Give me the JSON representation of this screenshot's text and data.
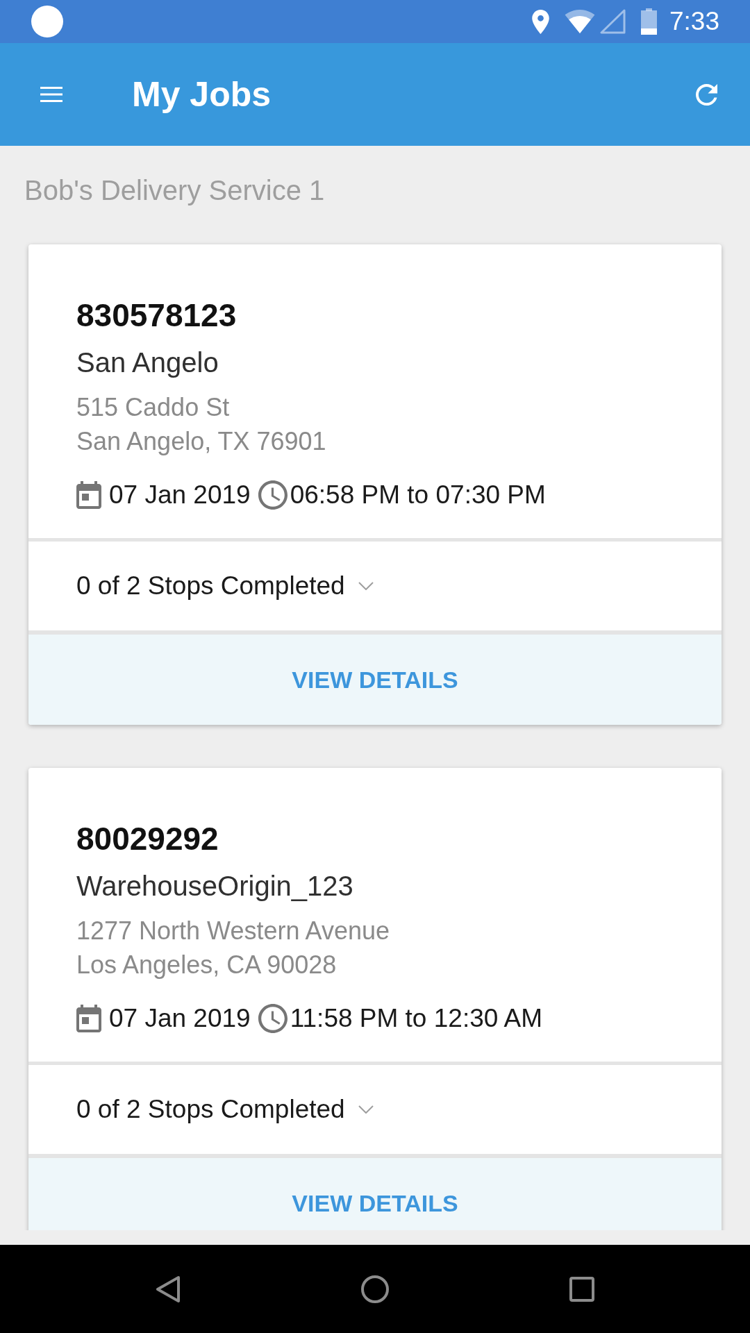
{
  "status_bar": {
    "time": "7:33"
  },
  "app_bar": {
    "title": "My Jobs"
  },
  "company": "Bob's Delivery Service 1",
  "jobs": [
    {
      "id": "830578123",
      "name": "San Angelo",
      "address_lines": [
        "515 Caddo St",
        "San Angelo, TX 76901"
      ],
      "date": "07 Jan 2019",
      "time_range": "06:58 PM to 07:30 PM",
      "stops": "0 of 2 Stops Completed",
      "expanded": false,
      "action": "VIEW DETAILS"
    },
    {
      "id": "80029292",
      "name": "WarehouseOrigin_123",
      "address_lines": [
        "1277 North Western Avenue",
        "Los Angeles, CA 90028"
      ],
      "date": "07 Jan 2019",
      "time_range": "11:58 PM to 12:30 AM",
      "stops": "0 of 2 Stops Completed",
      "expanded": false,
      "action": "VIEW DETAILS"
    }
  ]
}
